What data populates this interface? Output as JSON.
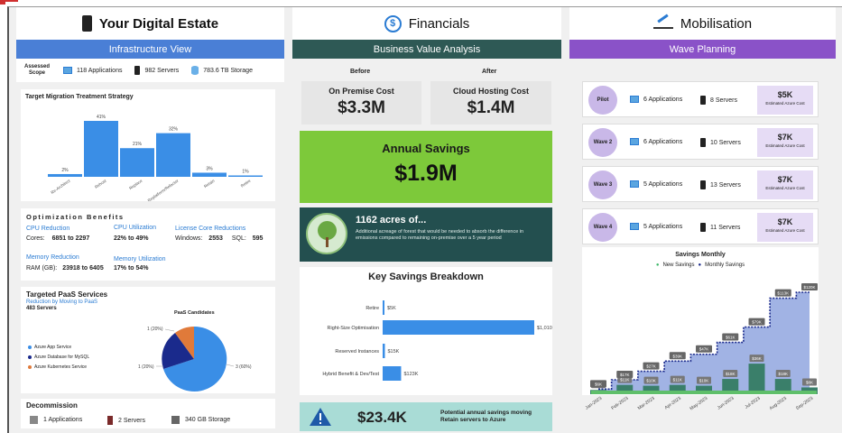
{
  "estate": {
    "title": "Your Digital Estate",
    "banner": "Infrastructure View",
    "assessed_label": "Assessed Scope",
    "applications": "118 Applications",
    "servers": "982 Servers",
    "storage": "783.6 TB Storage"
  },
  "migration": {
    "title": "Target Migration Treatment Strategy",
    "bars": [
      {
        "label": "Re-Architect",
        "pct": "2%",
        "value": 2
      },
      {
        "label": "Rehost",
        "pct": "41%",
        "value": 41
      },
      {
        "label": "Replace",
        "pct": "21%",
        "value": 21
      },
      {
        "label": "Replatform/Refactor",
        "pct": "32%",
        "value": 32
      },
      {
        "label": "Retain",
        "pct": "3%",
        "value": 3
      },
      {
        "label": "Retire",
        "pct": "1%",
        "value": 1
      }
    ]
  },
  "optimization": {
    "title": "Optimization Benefits",
    "cpu_reduction_label": "CPU Reduction",
    "cores_text": "Cores:",
    "cores_value": "6851 to 2297",
    "cpu_util_label": "CPU Utilization",
    "cpu_util_value": "22% to 49%",
    "license_label": "License Core Reductions",
    "windows_text": "Windows:",
    "windows_value": "2553",
    "sql_text": "SQL:",
    "sql_value": "595",
    "mem_reduction_label": "Memory Reduction",
    "ram_text": "RAM (GB):",
    "ram_value": "23918 to 6405",
    "mem_util_label": "Memory Utilization",
    "mem_util_value": "17% to 54%"
  },
  "paas": {
    "title": "Targeted PaaS Services",
    "subtitle": "Reduction by Moving to PaaS",
    "servers": "483 Servers",
    "chart_title": "PaaS Candidates",
    "legend": [
      "Azure App Service",
      "Azure Database for MySQL",
      "Azure Kubernetes Service"
    ],
    "slice_labels": [
      "1 (20%)",
      "1 (20%)",
      "3 (60%)"
    ]
  },
  "decommission": {
    "title": "Decommission",
    "applications": "1 Applications",
    "servers": "2 Servers",
    "storage": "340 GB Storage"
  },
  "financials": {
    "title": "Financials",
    "banner": "Business Value Analysis",
    "before_label": "Before",
    "after_label": "After",
    "onprem_label": "On Premise Cost",
    "onprem_value": "$3.3M",
    "cloud_label": "Cloud Hosting Cost",
    "cloud_value": "$1.4M",
    "savings_label": "Annual Savings",
    "savings_value": "$1.9M",
    "forest_title": "1162 acres of...",
    "forest_desc": "Additional acreage of forest that would be needed to absorb the difference in emissions compared to remaining on-premise over a 5 year period",
    "breakdown_title": "Key Savings Breakdown",
    "warning_value": "$23.4K",
    "warning_text": "Potential annual savings moving Retain servers to Azure"
  },
  "mobilisation": {
    "title": "Mobilisation",
    "banner": "Wave Planning",
    "cost_caption": "Estimated Azure Cost",
    "waves": [
      {
        "name": "Pilot",
        "apps": "6 Applications",
        "servers": "8 Servers",
        "cost": "$5K"
      },
      {
        "name": "Wave 2",
        "apps": "6 Applications",
        "servers": "10 Servers",
        "cost": "$7K"
      },
      {
        "name": "Wave 3",
        "apps": "5 Applications",
        "servers": "13 Servers",
        "cost": "$7K"
      },
      {
        "name": "Wave 4",
        "apps": "5 Applications",
        "servers": "11 Servers",
        "cost": "$7K"
      }
    ],
    "savings_title": "Savings Monthly",
    "legend_new": "New Savings",
    "legend_monthly": "Monthly Savings"
  },
  "colors": {
    "blue_banner": "#4a7fd6",
    "teal_banner": "#2e5955",
    "purple_banner": "#8a52c8",
    "green_savings": "#7dc93a",
    "forest": "#234f4f",
    "bar_blue": "#3a8ee6",
    "warning_bg": "#a9dcd6"
  },
  "chart_data": [
    {
      "type": "bar",
      "title": "Key Savings Breakdown",
      "categories": [
        "Retire",
        "Right-Size Optimisation",
        "Reserved Instances",
        "Hybrid Benefit & Dev/Test"
      ],
      "values": [
        5,
        1010,
        15,
        123
      ],
      "labels": [
        "$5K",
        "$1,010K",
        "$15K",
        "$123K"
      ],
      "orientation": "horizontal"
    },
    {
      "type": "bar",
      "title": "Savings Monthly",
      "categories": [
        "Jan-2023",
        "Feb-2023",
        "Mar-2023",
        "Apr-2023",
        "May-2023",
        "Jun-2023",
        "Jul-2023",
        "Aug-2023",
        "Sep-2023"
      ],
      "series": [
        {
          "name": "New Savings",
          "values": [
            5,
            11,
            10,
            11,
            10,
            18,
            36,
            18,
            8
          ],
          "labels": [
            "$5K",
            "$11K",
            "$10K",
            "$11K",
            "$10K",
            "$18K",
            "$36K",
            "$18K",
            "$8K"
          ]
        },
        {
          "name": "Monthly Savings",
          "values": [
            6,
            17,
            27,
            39,
            47,
            61,
            79,
            113,
            120
          ],
          "labels": [
            "$6K",
            "$17K",
            "$27K",
            "$39K",
            "$47K",
            "$61K",
            "$79K",
            "$113K",
            "$120K"
          ]
        }
      ]
    }
  ]
}
